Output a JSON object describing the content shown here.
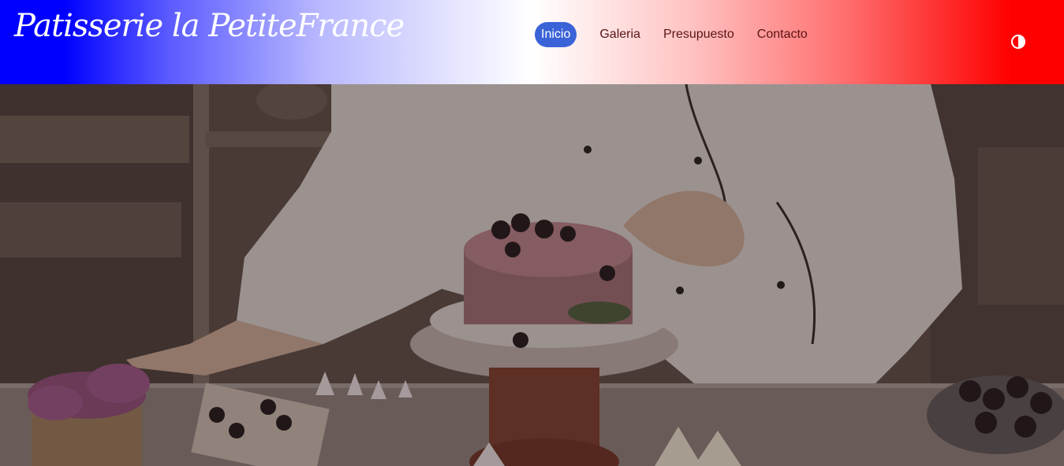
{
  "brand": {
    "name": "Patisserie la PetiteFrance"
  },
  "nav": {
    "items": [
      {
        "label": "Inicio",
        "active": true
      },
      {
        "label": "Galeria",
        "active": false
      },
      {
        "label": "Presupuesto",
        "active": false
      },
      {
        "label": "Contacto",
        "active": false
      }
    ]
  },
  "theme_toggle": {
    "icon": "contrast-icon"
  },
  "hero": {
    "image": "pastry-chef-decorating-cake-photo"
  },
  "colors": {
    "flag_blue": "#0000ff",
    "flag_white": "#ffffff",
    "flag_red": "#ff0000",
    "active_nav_bg": "#3b63d8",
    "nav_text": "#5a1414"
  }
}
